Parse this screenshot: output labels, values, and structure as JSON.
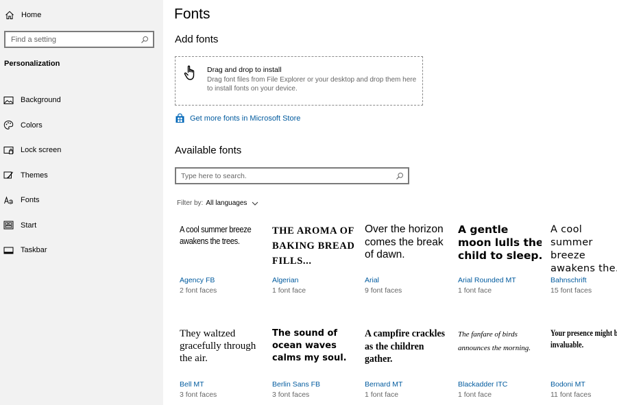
{
  "sidebar": {
    "home_label": "Home",
    "search_placeholder": "Find a setting",
    "section_title": "Personalization",
    "items": [
      {
        "label": "Background",
        "icon": "image-icon"
      },
      {
        "label": "Colors",
        "icon": "palette-icon"
      },
      {
        "label": "Lock screen",
        "icon": "lock-screen-icon"
      },
      {
        "label": "Themes",
        "icon": "themes-icon"
      },
      {
        "label": "Fonts",
        "icon": "fonts-icon"
      },
      {
        "label": "Start",
        "icon": "start-icon"
      },
      {
        "label": "Taskbar",
        "icon": "taskbar-icon"
      }
    ]
  },
  "main": {
    "title": "Fonts",
    "add_fonts_title": "Add fonts",
    "dropzone": {
      "title": "Drag and drop to install",
      "description": "Drag font files from File Explorer or your desktop and drop them here to install fonts on your device."
    },
    "store_link": "Get more fonts in Microsoft Store",
    "available_title": "Available fonts",
    "font_search_placeholder": "Type here to search.",
    "filter_label": "Filter by:",
    "filter_value": "All languages",
    "fonts": [
      {
        "sample": "A cool summer breeze awakens the trees.",
        "name": "Agency FB",
        "faces": "2 font faces"
      },
      {
        "sample": "THE AROMA OF BAKING BREAD FILLS...",
        "name": "Algerian",
        "faces": "1 font face"
      },
      {
        "sample": "Over the horizon comes the break of dawn.",
        "name": "Arial",
        "faces": "9 font faces"
      },
      {
        "sample": "A gentle moon lulls the child to sleep.",
        "name": "Arial Rounded MT",
        "faces": "1 font face"
      },
      {
        "sample": "A cool summer breeze awakens the...",
        "name": "Bahnschrift",
        "faces": "15 font faces"
      },
      {
        "sample": "They waltzed gracefully through the air.",
        "name": "Bell MT",
        "faces": "3 font faces"
      },
      {
        "sample": "The sound of ocean waves calms my soul.",
        "name": "Berlin Sans FB",
        "faces": "3 font faces"
      },
      {
        "sample": "A campfire crackles as the children gather.",
        "name": "Bernard MT",
        "faces": "1 font face"
      },
      {
        "sample": "The fanfare of birds announces the morning.",
        "name": "Blackadder ITC",
        "faces": "1 font face"
      },
      {
        "sample": "Your presence might be invaluable.",
        "name": "Bodoni MT",
        "faces": "11 font faces"
      }
    ]
  },
  "colors": {
    "accent_link": "#005a9e",
    "sidebar_bg": "#f2f2f2"
  }
}
